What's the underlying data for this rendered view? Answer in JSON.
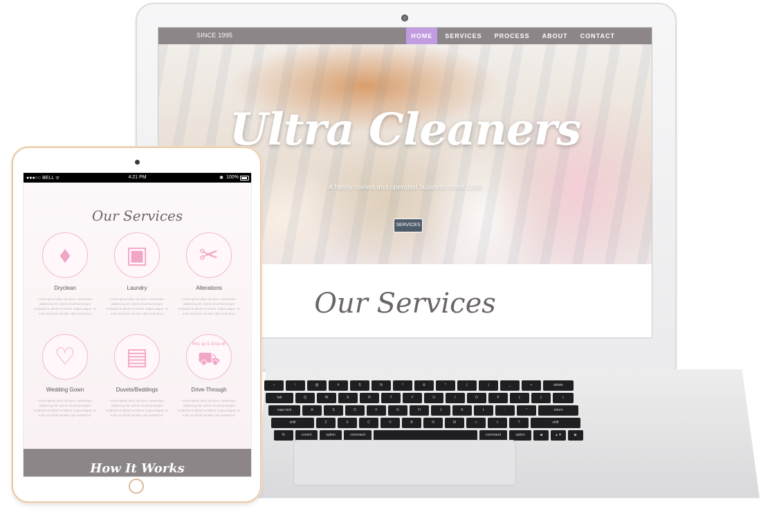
{
  "laptop": {
    "nav": {
      "brand": "SINCE 1995",
      "links": [
        "HOME",
        "SERVICES",
        "PROCESS",
        "ABOUT",
        "CONTACT"
      ],
      "active": "HOME",
      "active_color": "#c29ce0",
      "bar_color": "#8c8689"
    },
    "hero": {
      "title": "Ultra Cleaners",
      "tagline": "A family owned and operated business since 1995",
      "button_label": "SERVICES"
    },
    "section_title": "Our Services",
    "keyboard": {
      "row1": [
        "~",
        "!",
        "@",
        "#",
        "$",
        "%",
        "^",
        "&",
        "*",
        "(",
        ")",
        "_",
        "+",
        "delete"
      ],
      "row2": [
        "tab",
        "Q",
        "W",
        "E",
        "R",
        "T",
        "Y",
        "U",
        "I",
        "O",
        "P",
        "{",
        "}",
        "|"
      ],
      "row3": [
        "caps lock",
        "A",
        "S",
        "D",
        "F",
        "G",
        "H",
        "J",
        "K",
        "L",
        ":",
        "\"",
        "return"
      ],
      "row4": [
        "shift",
        "Z",
        "X",
        "C",
        "V",
        "B",
        "N",
        "M",
        "<",
        ">",
        "?",
        "shift"
      ],
      "row5": [
        "fn",
        "control",
        "option",
        "command",
        "",
        "command",
        "option",
        "◀",
        "▲▼",
        "▶"
      ]
    }
  },
  "tablet": {
    "status": {
      "carrier": "●●●○○ BELL ᯤ",
      "time": "4:21 PM",
      "bluetooth": "✱",
      "battery": "100%"
    },
    "section_title": "Our Services",
    "services": [
      {
        "name": "Dryclean",
        "icon": "suit-icon",
        "glyph": "♦"
      },
      {
        "name": "Laundry",
        "icon": "washing-machine-icon",
        "glyph": "▣"
      },
      {
        "name": "Alterations",
        "icon": "spool-needle-icon",
        "glyph": "✂"
      },
      {
        "name": "Wedding Gown",
        "icon": "wedding-dress-icon",
        "glyph": "♡"
      },
      {
        "name": "Duvets/Beddings",
        "icon": "bed-icon",
        "glyph": "▤"
      },
      {
        "name": "Drive-Through",
        "icon": "car-icon",
        "glyph": "⛟",
        "badge": "Pick up & Drop-off"
      }
    ],
    "service_desc": "Lorem ipsum dolor sit amet, consectetur adipiscing elit, sed do eiusmod tempor incididunt ut labore et dolore magna aliqua. Ut enim ad minim veniam, quis nostrud ex",
    "footer_title": "How It Works",
    "accent_color": "#f2a6c7"
  }
}
